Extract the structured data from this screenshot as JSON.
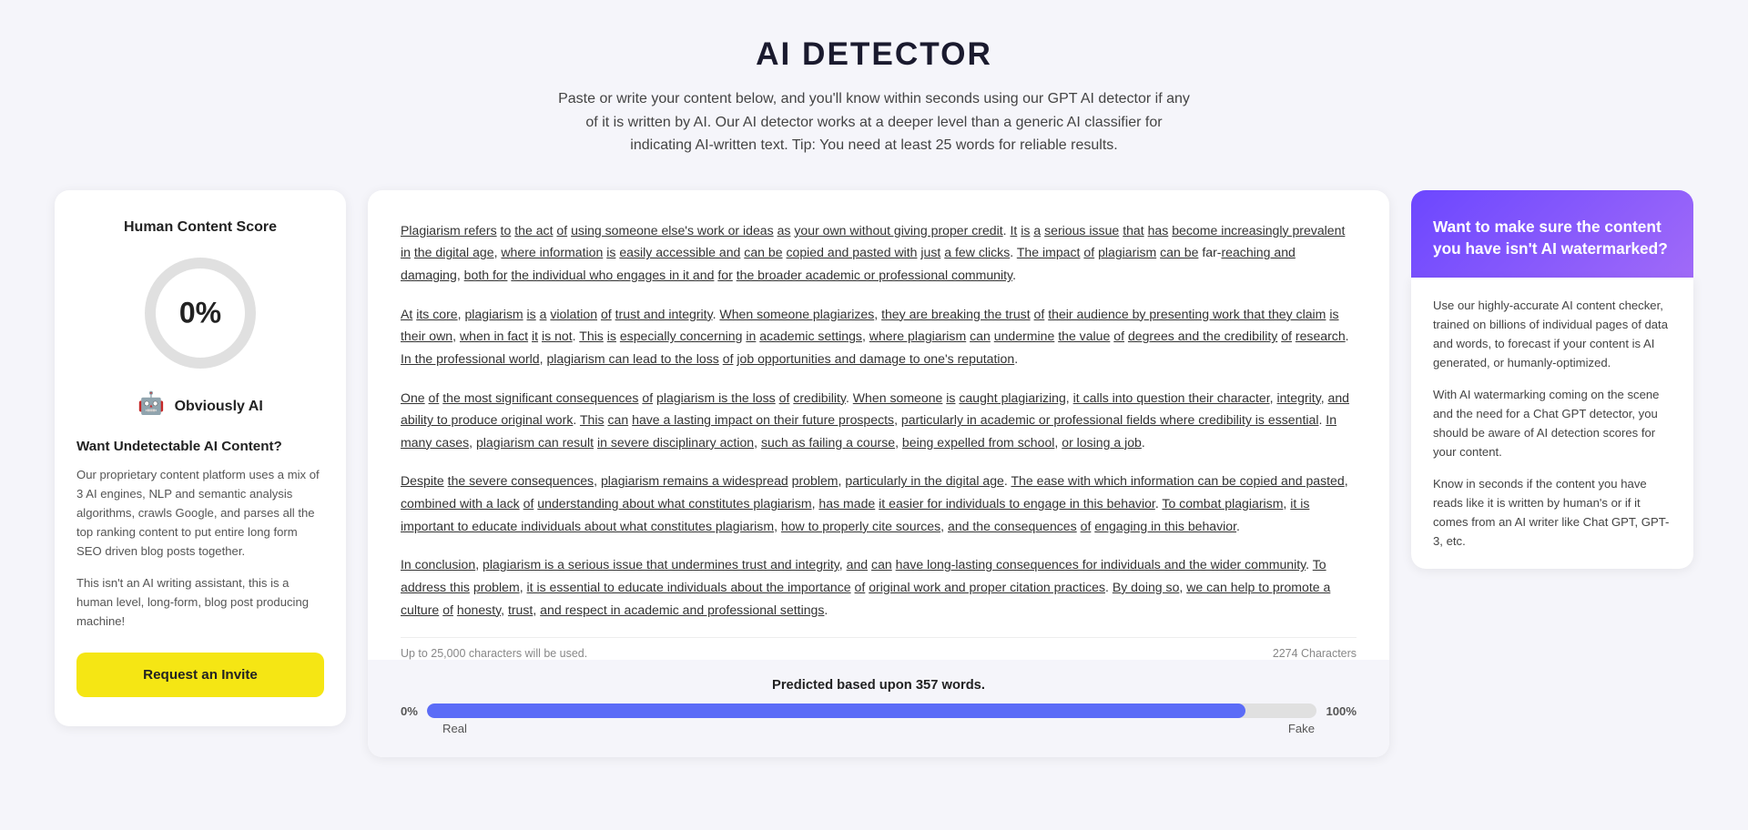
{
  "header": {
    "title": "AI DETECTOR",
    "description": "Paste or write your content below, and you'll know within seconds using our GPT AI detector if any of it is written by AI. Our AI detector works at a deeper level than a generic AI classifier for indicating AI-written text. Tip: You need at least 25 words for reliable results."
  },
  "left_panel": {
    "score_title": "Human Content Score",
    "score_value": "0%",
    "score_label": "Obviously AI",
    "want_title": "Want Undetectable AI Content?",
    "desc1": "Our proprietary content platform uses a mix of 3 AI engines, NLP and semantic analysis algorithms, crawls Google, and parses all the top ranking content to put entire long form SEO driven blog posts together.",
    "desc2": "This isn't an AI writing assistant, this is a human level, long-form, blog post producing machine!",
    "btn_label": "Request an Invite"
  },
  "center_panel": {
    "paragraphs": [
      "Plagiarism refers to the act of using someone else's work or ideas as your own without giving proper credit. It is a serious issue that has become increasingly prevalent in the digital age, where information is easily accessible and can be copied and pasted with just a few clicks. The impact of plagiarism can be far-reaching and damaging, both for the individual who engages in it and for the broader academic or professional community.",
      "At its core, plagiarism is a violation of trust and integrity. When someone plagiarizes, they are breaking the trust of their audience by presenting work that they claim is their own, when in fact it is not. This is especially concerning in academic settings, where plagiarism can undermine the value of degrees and the credibility of research. In the professional world, plagiarism can lead to the loss of job opportunities and damage to one's reputation.",
      "One of the most significant consequences of plagiarism is the loss of credibility. When someone is caught plagiarizing, it calls into question their character, integrity, and ability to produce original work. This can have a lasting impact on their future prospects, particularly in academic or professional fields where credibility is essential. In many cases, plagiarism can result in severe disciplinary action, such as failing a course, being expelled from school, or losing a job.",
      "Despite the severe consequences, plagiarism remains a widespread problem, particularly in the digital age. The ease with which information can be copied and pasted, combined with a lack of understanding about what constitutes plagiarism, has made it easier for individuals to engage in this behavior. To combat plagiarism, it is important to educate individuals about what constitutes plagiarism, how to properly cite sources, and the consequences of engaging in this behavior.",
      "In conclusion, plagiarism is a serious issue that undermines trust and integrity, and can have long-lasting consequences for individuals and the wider community. To address this problem, it is essential to educate individuals about the importance of original work and proper citation practices. By doing so, we can help to promote a culture of honesty, trust, and respect in academic and professional settings."
    ],
    "footer_left": "Up to 25,000 characters will be used.",
    "footer_right": "2274 Characters",
    "prediction": {
      "title": "Predicted based upon",
      "words": "357 words",
      "left_pct": "0%",
      "left_label": "Real",
      "right_pct": "100%",
      "right_label": "Fake",
      "bar_fill_pct": 92
    }
  },
  "right_panel": {
    "watermark_title": "Want to make sure the content you have isn't AI watermarked?",
    "info1": "Use our highly-accurate AI content checker, trained on billions of individual pages of data and words, to forecast if your content is AI generated, or humanly-optimized.",
    "info2": "With AI watermarking coming on the scene and the need for a Chat GPT detector, you should be aware of AI detection scores for your content.",
    "info3": "Know in seconds if the content you have reads like it is written by human's or if it comes from an AI writer like Chat GPT, GPT-3, etc."
  },
  "colors": {
    "accent_purple": "#6c47ff",
    "accent_yellow": "#f5e614",
    "bar_blue": "#5b6cf7",
    "score_circle": "#e0e0e0"
  }
}
